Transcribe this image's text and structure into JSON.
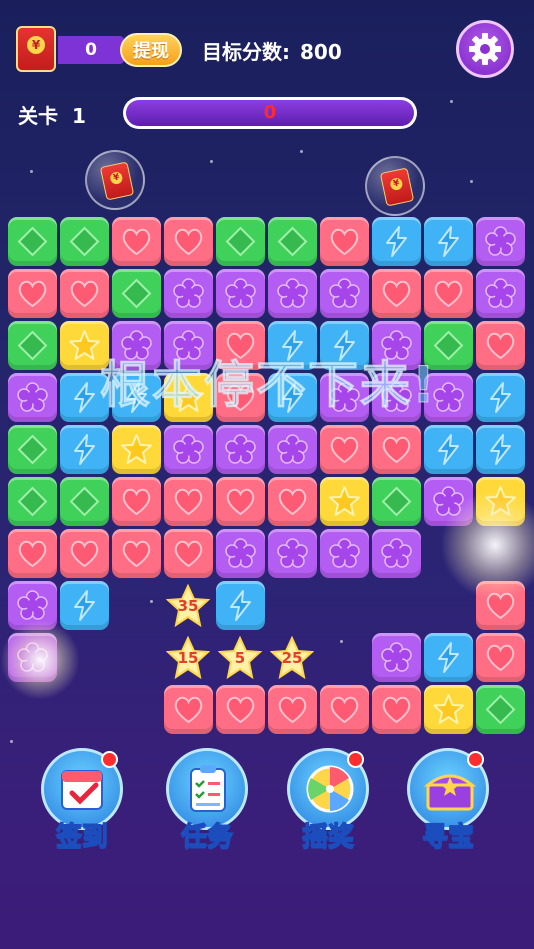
{
  "header": {
    "balance": "0",
    "withdraw_label": "提现",
    "target_label": "目标分数:",
    "target_value": "800",
    "level_label": "关卡",
    "level_value": "1",
    "progress_value": "0",
    "coin_symbol": "¥"
  },
  "board": {
    "rows": [
      [
        "green",
        "green",
        "red",
        "red",
        "green",
        "green",
        "red",
        "blue",
        "blue",
        "purple"
      ],
      [
        "red",
        "red",
        "green",
        "purple",
        "purple",
        "purple",
        "purple",
        "red",
        "red",
        "purple"
      ],
      [
        "green",
        "yellow",
        "purple",
        "purple",
        "red",
        "blue",
        "blue",
        "purple",
        "green",
        "red"
      ],
      [
        "purple",
        "blue",
        "blue",
        "yellow",
        "red",
        "blue",
        "purple",
        "purple",
        "purple",
        "blue"
      ],
      [
        "green",
        "blue",
        "yellow",
        "purple",
        "purple",
        "purple",
        "red",
        "red",
        "blue",
        "blue"
      ],
      [
        "green",
        "green",
        "red",
        "red",
        "red",
        "red",
        "yellow",
        "green",
        "purple",
        "yellow"
      ],
      [
        "red",
        "red",
        "red",
        "red",
        "purple",
        "purple",
        "purple",
        "purple",
        "",
        ""
      ],
      [
        "purple",
        "blue",
        "",
        "",
        "blue",
        "",
        "",
        "",
        "",
        "red"
      ],
      [
        "purple",
        "",
        "",
        "",
        "",
        "",
        "",
        "purple",
        "blue",
        "red"
      ],
      [
        "",
        "",
        "",
        "red",
        "red",
        "red",
        "red",
        "red",
        "yellow",
        "green"
      ]
    ],
    "floating_scores": [
      "35",
      "15",
      "5",
      "25"
    ],
    "watermark": "根本停不下来!"
  },
  "bottom_menu": [
    {
      "label": "签到",
      "icon": "calendar-checkin-icon"
    },
    {
      "label": "任务",
      "icon": "task-clipboard-icon"
    },
    {
      "label": "摇奖",
      "icon": "prize-wheel-icon"
    },
    {
      "label": "寻宝",
      "icon": "treasure-chest-icon"
    }
  ],
  "colors": {
    "green": "#3fd15a",
    "red": "#ff6e85",
    "blue": "#3fb3f6",
    "purple": "#b45df3",
    "yellow": "#ffd93a"
  }
}
